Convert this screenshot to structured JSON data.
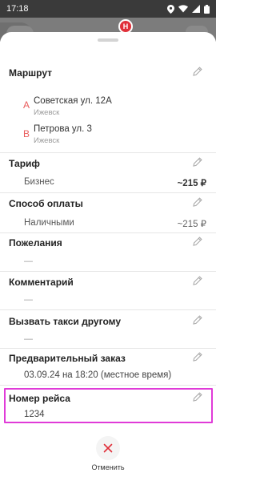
{
  "status_bar": {
    "time": "17:18"
  },
  "map": {
    "pin_label": "H"
  },
  "route": {
    "title": "Маршрут",
    "points": [
      {
        "letter": "A",
        "street": "Советская ул. 12А",
        "city": "Ижевск"
      },
      {
        "letter": "B",
        "street": "Петрова ул. 3",
        "city": "Ижевск"
      }
    ]
  },
  "tariff": {
    "title": "Тариф",
    "name": "Бизнес",
    "price": "~215 ₽"
  },
  "payment": {
    "title": "Способ оплаты",
    "method": "Наличными",
    "price": "~215 ₽"
  },
  "wishes": {
    "title": "Пожелания",
    "value": "—"
  },
  "comment": {
    "title": "Комментарий",
    "value": "—"
  },
  "call_for_other": {
    "title": "Вызвать такси другому",
    "value": "—"
  },
  "preorder": {
    "title": "Предварительный заказ",
    "value": "03.09.24 на 18:20 (местное время)"
  },
  "flight": {
    "title": "Номер рейса",
    "value": "1234"
  },
  "cancel": {
    "label": "Отменить"
  },
  "colors": {
    "accent": "#e95c5c",
    "highlight": "#e03bd8",
    "cancel_x": "#e0303a"
  }
}
